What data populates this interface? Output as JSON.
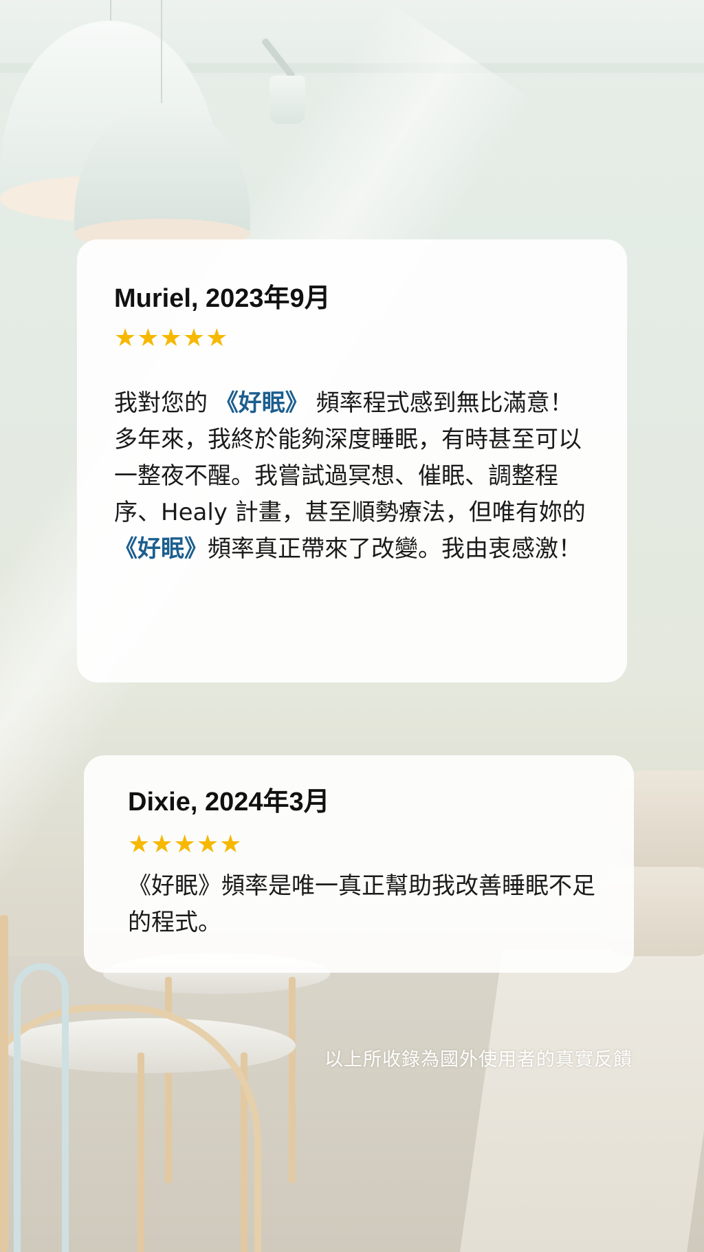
{
  "reviews": [
    {
      "name": "Muriel, 2023年9月",
      "stars": "★★★★★",
      "rating": 5,
      "text": {
        "seg1": "我對您的 ",
        "hl1": "《好眠》",
        "seg2": " 頻率程式感到無比滿意！多年來，我終於能夠深度睡眠，有時甚至可以一整夜不醒。我嘗試過冥想、催眠、調整程序、Healy 計畫，甚至順勢療法，但唯有妳的",
        "hl2": "《好眠》",
        "seg3": "頻率真正帶來了改變。我由衷感激！"
      }
    },
    {
      "name": "Dixie, 2024年3月",
      "stars": "★★★★★",
      "rating": 5,
      "text": "《好眠》頻率是唯一真正幫助我改善睡眠不足的程式。"
    }
  ],
  "footer": {
    "caption": "以上所收錄為國外使用者的真實反饋"
  },
  "colors": {
    "star": "#f6b800",
    "highlight": "#1c5e8e",
    "card": "#ffffff"
  }
}
